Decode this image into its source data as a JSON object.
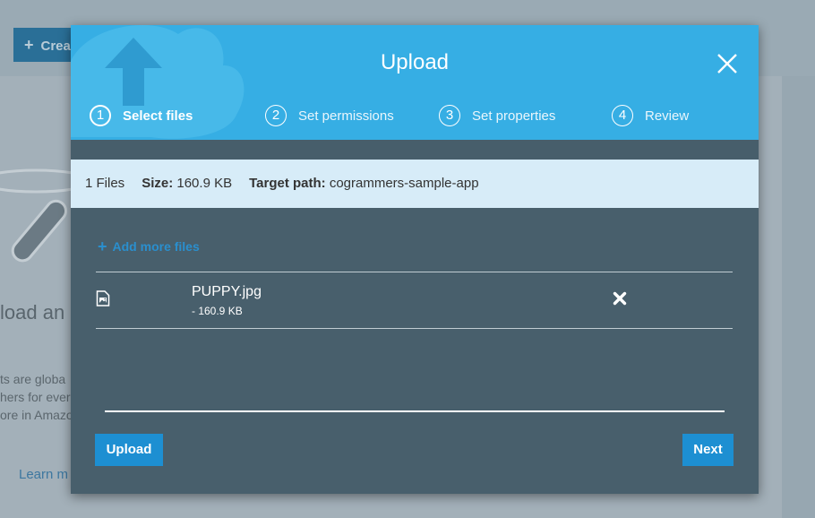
{
  "background": {
    "create_button": "Crea",
    "heading": "load an",
    "paragraph": "ts are globa\nhers for ever\nore in Amazo",
    "learn_more": "Learn m"
  },
  "modal": {
    "title": "Upload",
    "close_icon": "close-icon",
    "steps": [
      {
        "number": "1",
        "label": "Select files",
        "active": true
      },
      {
        "number": "2",
        "label": "Set permissions",
        "active": false
      },
      {
        "number": "3",
        "label": "Set properties",
        "active": false
      },
      {
        "number": "4",
        "label": "Review",
        "active": false
      }
    ],
    "summary": {
      "files": "1 Files",
      "size_label": "Size:",
      "size_value": "160.9 KB",
      "target_label": "Target path:",
      "target_value": "cogrammers-sample-app"
    },
    "add_more": "Add more files",
    "files": [
      {
        "name": "PUPPY.jpg",
        "size": "- 160.9 KB",
        "icon": "image-file-icon"
      }
    ],
    "buttons": {
      "upload": "Upload",
      "next": "Next"
    }
  },
  "colors": {
    "header_blue": "#36aee4",
    "modal_body": "#485f6c",
    "info_bar": "#d7ecf8",
    "button_blue": "#1d8fd2",
    "link_blue": "#2a8fce"
  }
}
